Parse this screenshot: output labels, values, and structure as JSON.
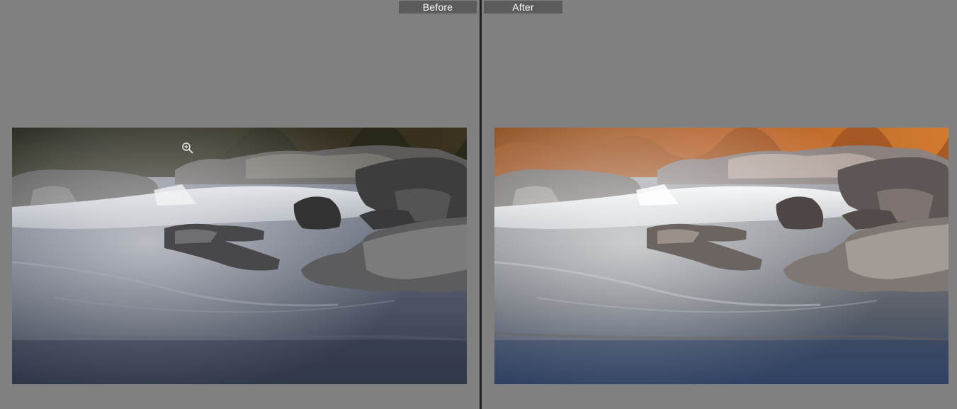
{
  "compare": {
    "before_label": "Before",
    "after_label": "After"
  },
  "colors": {
    "background": "#808080",
    "label_bg": "#5b5b5b",
    "divider": "#1e1e1e"
  },
  "icons": {
    "cursor": "zoom-in-icon"
  }
}
